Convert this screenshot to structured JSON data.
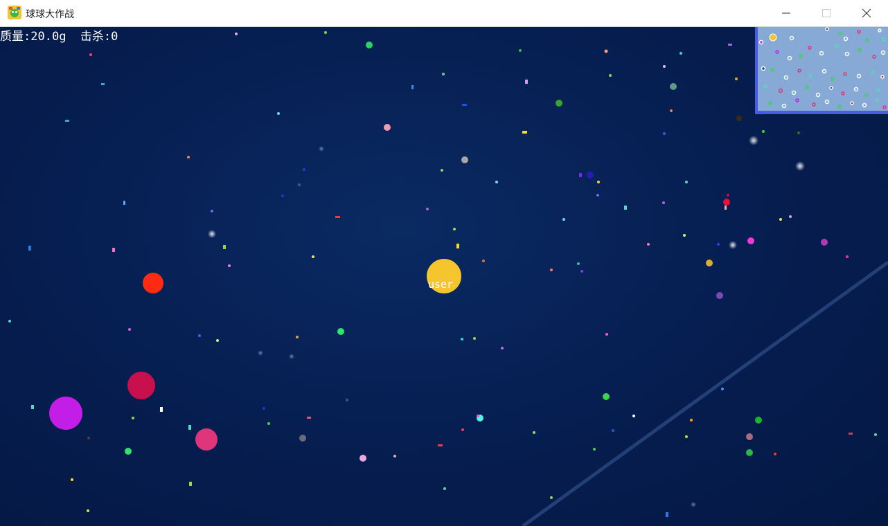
{
  "window": {
    "title": "球球大作战",
    "icon": "game-app-icon",
    "controls": [
      "minimize-icon",
      "maximize-icon",
      "close-icon"
    ]
  },
  "hud": {
    "mass_label": "质量:",
    "mass_value": "20.0g",
    "kills_label": "击杀:",
    "kills_value": "0"
  },
  "player": {
    "name": "user",
    "color": "#f5c52e"
  },
  "colors": {
    "background": "#051b4b",
    "minimap_bg": "#86a9d6",
    "minimap_border": "#4a5ce6",
    "enemy_red": "#ff2a12",
    "enemy_crimson": "#c8104e",
    "enemy_purple": "#c31ee8",
    "enemy_pink": "#e0357a"
  }
}
